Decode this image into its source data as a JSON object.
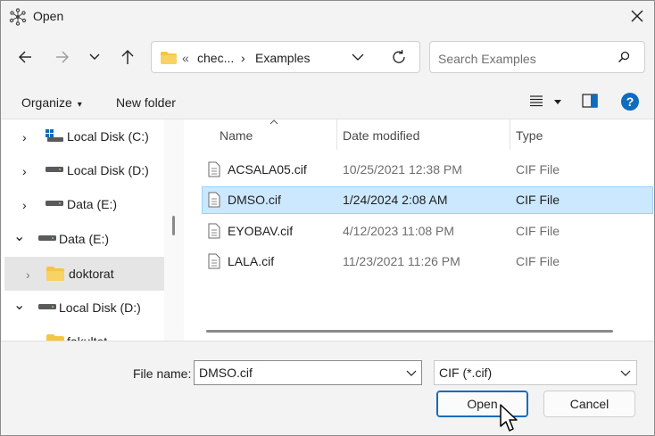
{
  "window": {
    "title": "Open",
    "title_icon": "atom-icon",
    "close_icon": "close-icon"
  },
  "nav": {
    "back_icon": "arrow-left-icon",
    "forward_icon": "arrow-right-icon",
    "recent_icon": "chevron-down-icon",
    "up_icon": "arrow-up-icon",
    "address": {
      "overflow": "«",
      "segments": [
        "chec...",
        "Examples"
      ],
      "separator": "›"
    },
    "search_placeholder": "Search Examples"
  },
  "commands": {
    "organize": "Organize",
    "organize_caret": "▾",
    "new_folder": "New folder"
  },
  "tree": {
    "items": [
      {
        "label": "Local Disk (C:)",
        "icon": "windows-drive-icon",
        "chevron": "›"
      },
      {
        "label": "Local Disk (D:)",
        "icon": "drive-icon",
        "chevron": "›"
      },
      {
        "label": "Data (E:)",
        "icon": "drive-icon",
        "chevron": "›"
      },
      {
        "label": "Data (E:)",
        "icon": "drive-icon",
        "chevron": "⌄"
      },
      {
        "label": "doktorat",
        "icon": "folder-icon",
        "chevron": "›"
      },
      {
        "label": "Local Disk (D:)",
        "icon": "drive-icon",
        "chevron": "⌄"
      },
      {
        "label": "fakultet",
        "icon": "folder-icon",
        "chevron": "›"
      }
    ]
  },
  "columns": {
    "name": "Name",
    "date": "Date modified",
    "type": "Type"
  },
  "files": [
    {
      "name": "ACSALA05.cif",
      "date": "10/25/2021 12:38 PM",
      "type": "CIF File",
      "selected": false
    },
    {
      "name": "DMSO.cif",
      "date": "1/24/2024 2:08 AM",
      "type": "CIF File",
      "selected": true
    },
    {
      "name": "EYOBAV.cif",
      "date": "4/12/2023 11:08 PM",
      "type": "CIF File",
      "selected": false
    },
    {
      "name": "LALA.cif",
      "date": "11/23/2021 11:26 PM",
      "type": "CIF File",
      "selected": false
    }
  ],
  "bottom": {
    "filename_label": "File name:",
    "filename_value": "DMSO.cif",
    "filetype_value": "CIF (*.cif)",
    "open_label": "Open",
    "cancel_label": "Cancel"
  },
  "colors": {
    "accent": "#0f6cbd",
    "selection": "#cce8ff",
    "folder": "#f6c544"
  }
}
